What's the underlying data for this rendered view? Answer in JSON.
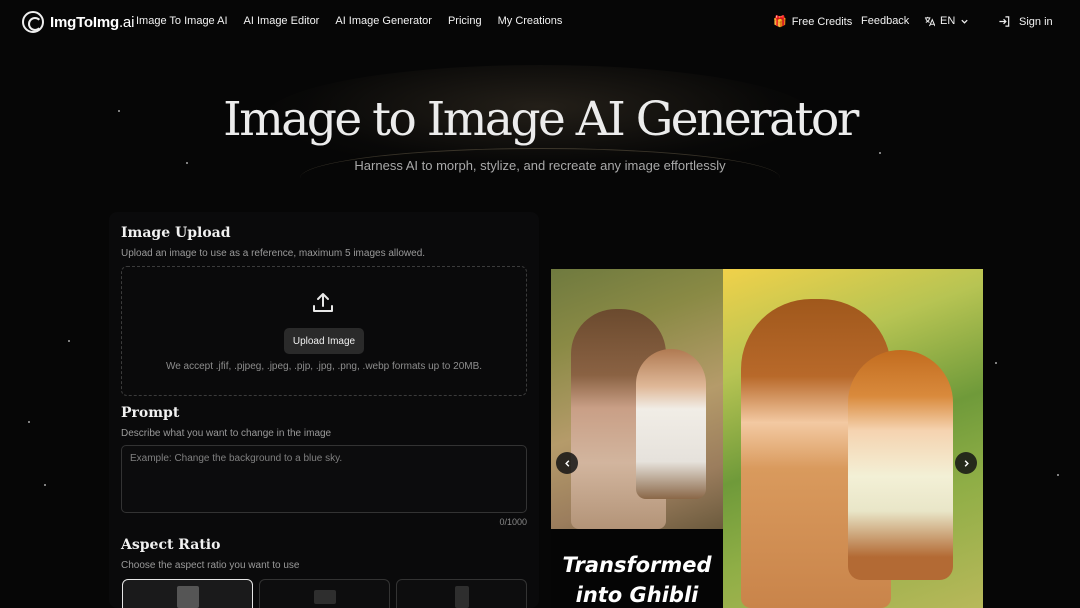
{
  "brand": {
    "name": "ImgToImg",
    "suffix": ".ai"
  },
  "nav": {
    "links": [
      "Image To Image AI",
      "AI Image Editor",
      "AI Image Generator",
      "Pricing",
      "My Creations"
    ],
    "free_credits": "Free Credits",
    "feedback": "Feedback",
    "language": "EN",
    "sign_in": "Sign in"
  },
  "hero": {
    "title": "Image to Image AI Generator",
    "subtitle": "Harness AI to morph, stylize, and recreate any image effortlessly"
  },
  "upload": {
    "title": "Image Upload",
    "description": "Upload an image to use as a reference, maximum 5 images allowed.",
    "button": "Upload Image",
    "formats": "We accept .jfif, .pjpeg, .jpeg, .pjp, .jpg, .png, .webp formats up to 20MB."
  },
  "prompt": {
    "title": "Prompt",
    "description": "Describe what you want to change in the image",
    "placeholder": "Example: Change the background to a blue sky.",
    "counter": "0/1000"
  },
  "aspect": {
    "title": "Aspect Ratio",
    "description": "Choose the aspect ratio you want to use"
  },
  "showcase": {
    "caption_line1": "Transformed",
    "caption_line2": "into Ghibli"
  },
  "icons": {
    "logo": "spiral-logo-icon",
    "gift": "gift-icon",
    "translate": "translate-icon",
    "chevron": "chevron-down-icon",
    "signin": "sign-in-icon",
    "upload": "upload-icon",
    "prev": "chevron-left-icon",
    "next": "chevron-right-icon"
  }
}
